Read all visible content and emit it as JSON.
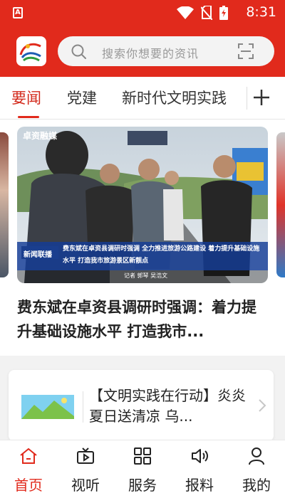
{
  "status_bar": {
    "time": "8:31",
    "app_icon_letter": "A",
    "icons": [
      "wifi-icon",
      "no-sim-icon",
      "battery-icon"
    ]
  },
  "header": {
    "logo": "app-logo",
    "search_placeholder": "搜索你想要的资讯",
    "colors": {
      "brand_red": "#e12a1c",
      "search_bg": "#f3f3f3"
    }
  },
  "tabs": {
    "items": [
      {
        "label": "要闻",
        "active": true
      },
      {
        "label": "党建",
        "active": false
      },
      {
        "label": "新时代文明实践",
        "active": false
      }
    ],
    "add_icon": "plus-icon"
  },
  "hero": {
    "image_overlay_logo": "卓资融媒",
    "image_caption": "费东斌在卓资县调研时强调 全力推进旅游公路建设 着力提升基础设施水平 打造我市旅游景区新靓点",
    "image_badge": "新闻联播",
    "image_credit": "记者 郭琴 吴浩文",
    "title": "费东斌在卓资县调研时强调：着力提升基础设施水平 打造我市..."
  },
  "article": {
    "title": "【文明实践在行动】炎炎夏日送清凉 乌...",
    "thumbnail": "landscape-image-icon"
  },
  "bottom_nav": {
    "items": [
      {
        "label": "首页",
        "icon": "home-icon",
        "active": true
      },
      {
        "label": "视听",
        "icon": "video-icon",
        "active": false
      },
      {
        "label": "服务",
        "icon": "grid-icon",
        "active": false
      },
      {
        "label": "报料",
        "icon": "speaker-icon",
        "active": false
      },
      {
        "label": "我的",
        "icon": "user-icon",
        "active": false
      }
    ]
  }
}
